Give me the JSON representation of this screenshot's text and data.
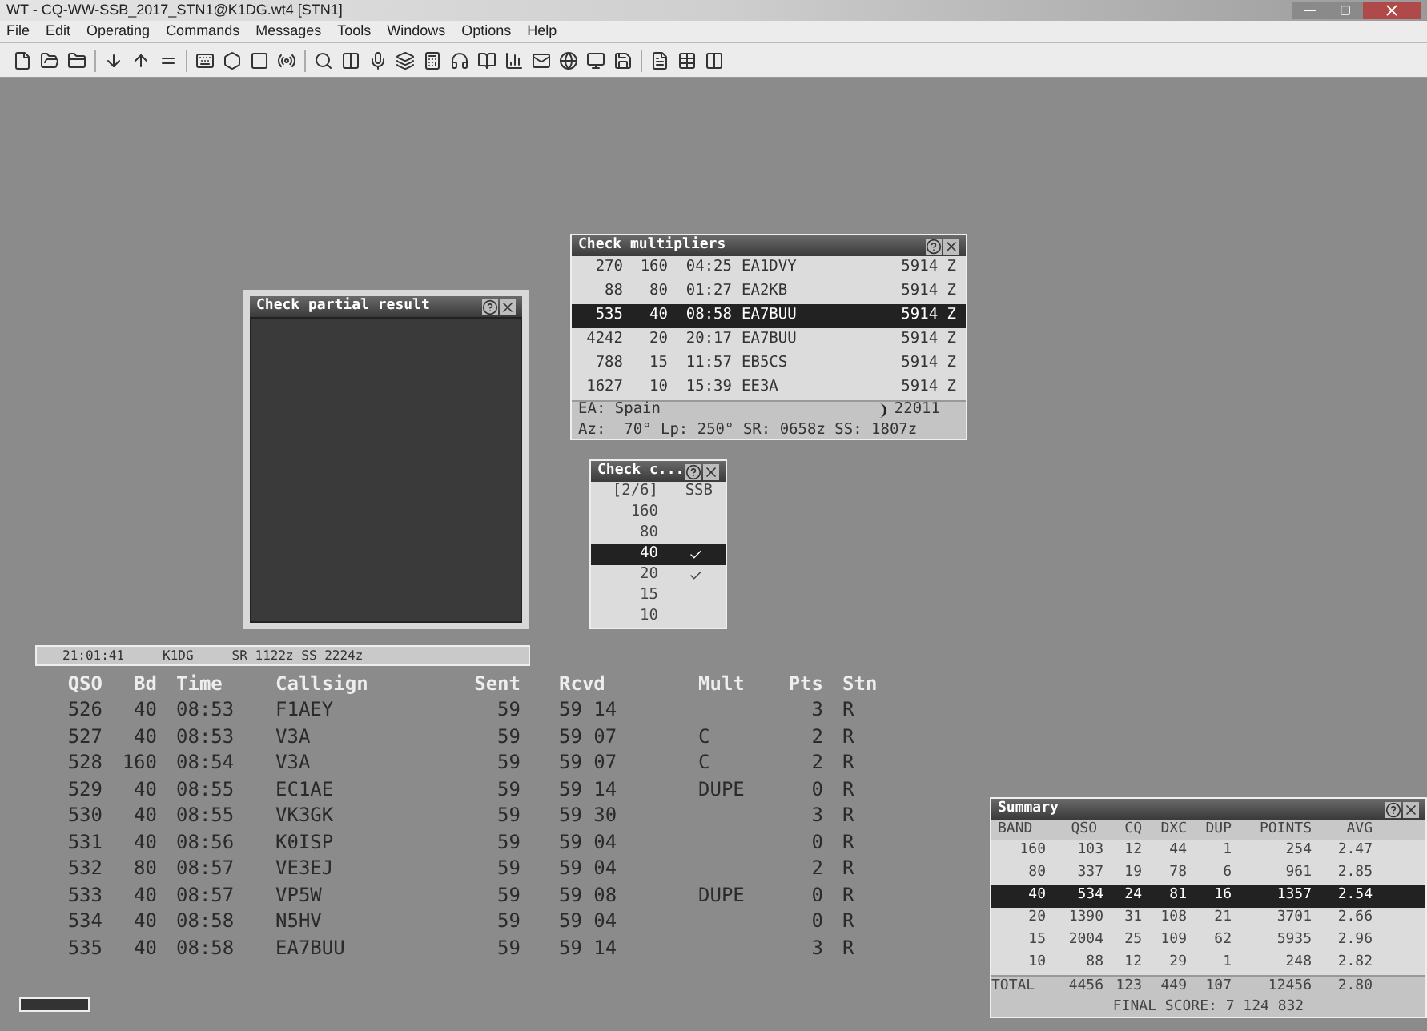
{
  "window": {
    "title": "WT - CQ-WW-SSB_2017_STN1@K1DG.wt4 [STN1]"
  },
  "menu": [
    "File",
    "Edit",
    "Operating",
    "Commands",
    "Messages",
    "Tools",
    "Windows",
    "Options",
    "Help"
  ],
  "check_multipliers": {
    "title": "Check multipliers",
    "rows": [
      {
        "qso": "270",
        "band": "160",
        "time": "04:25",
        "callsign": "EA1DVY",
        "col_5": "5914 Z",
        "selected": false
      },
      {
        "qso": "88",
        "band": "80",
        "time": "01:27",
        "callsign": "EA2KB",
        "col_5": "5914 Z",
        "selected": false
      },
      {
        "qso": "535",
        "band": "40",
        "time": "08:58",
        "callsign": "EA7BUU",
        "col_5": "5914 Z",
        "selected": true
      },
      {
        "qso": "4242",
        "band": "20",
        "time": "20:17",
        "callsign": "EA7BUU",
        "col_5": "5914 Z",
        "selected": false
      },
      {
        "qso": "788",
        "band": "15",
        "time": "11:57",
        "callsign": "EB5CS",
        "col_5": "5914 Z",
        "selected": false
      },
      {
        "qso": "1627",
        "band": "10",
        "time": "15:39",
        "callsign": "EE3A",
        "col_5": "5914 Z",
        "selected": false
      }
    ],
    "country": "EA: Spain",
    "zone": "22011",
    "bearing": "Az:  70° Lp: 250° SR: 0658z SS: 1807z"
  },
  "check_partial": {
    "title": "Check partial result"
  },
  "check_bands": {
    "title": "Check c...",
    "header": [
      "[2/6]",
      "SSB"
    ],
    "rows": [
      {
        "band": "160",
        "checked": false,
        "selected": false
      },
      {
        "band": "80",
        "checked": false,
        "selected": false
      },
      {
        "band": "40",
        "checked": true,
        "selected": true
      },
      {
        "band": "20",
        "checked": true,
        "selected": false
      },
      {
        "band": "15",
        "checked": false,
        "selected": false
      },
      {
        "band": "10",
        "checked": false,
        "selected": false
      }
    ]
  },
  "status_strip": [
    "21:01:41",
    "K1DG",
    "SR 1122z SS 2224z"
  ],
  "log": {
    "columns": [
      "QSO",
      "Bd",
      "Time",
      "Callsign",
      "Sent",
      "Rcvd",
      "Mult",
      "Pts",
      "Stn"
    ],
    "rows": [
      [
        "526",
        "40",
        "08:53",
        "F1AEY",
        "59",
        "59 14",
        "",
        "3",
        "R"
      ],
      [
        "527",
        "40",
        "08:53",
        "V3A",
        "59",
        "59 07",
        "C",
        "2",
        "R"
      ],
      [
        "528",
        "160",
        "08:54",
        "V3A",
        "59",
        "59 07",
        "C",
        "2",
        "R"
      ],
      [
        "529",
        "40",
        "08:55",
        "EC1AE",
        "59",
        "59 14",
        "DUPE",
        "0",
        "R"
      ],
      [
        "530",
        "40",
        "08:55",
        "VK3GK",
        "59",
        "59 30",
        "",
        "3",
        "R"
      ],
      [
        "531",
        "40",
        "08:56",
        "K0ISP",
        "59",
        "59 04",
        "",
        "0",
        "R"
      ],
      [
        "532",
        "80",
        "08:57",
        "VE3EJ",
        "59",
        "59 04",
        "",
        "2",
        "R"
      ],
      [
        "533",
        "40",
        "08:57",
        "VP5W",
        "59",
        "59 08",
        "DUPE",
        "0",
        "R"
      ],
      [
        "534",
        "40",
        "08:58",
        "N5HV",
        "59",
        "59 04",
        "",
        "0",
        "R"
      ],
      [
        "535",
        "40",
        "08:58",
        "EA7BUU",
        "59",
        "59 14",
        "",
        "3",
        "R"
      ]
    ]
  },
  "summary": {
    "title": "Summary",
    "columns": [
      "BAND",
      "QSO",
      "CQ",
      "DXC",
      "DUP",
      "POINTS",
      "AVG"
    ],
    "rows": [
      {
        "cells": [
          "160",
          "103",
          "12",
          "44",
          "1",
          "254",
          "2.47"
        ],
        "selected": false
      },
      {
        "cells": [
          "80",
          "337",
          "19",
          "78",
          "6",
          "961",
          "2.85"
        ],
        "selected": false
      },
      {
        "cells": [
          "40",
          "534",
          "24",
          "81",
          "16",
          "1357",
          "2.54"
        ],
        "selected": true
      },
      {
        "cells": [
          "20",
          "1390",
          "31",
          "108",
          "21",
          "3701",
          "2.66"
        ],
        "selected": false
      },
      {
        "cells": [
          "15",
          "2004",
          "25",
          "109",
          "62",
          "5935",
          "2.96"
        ],
        "selected": false
      },
      {
        "cells": [
          "10",
          "88",
          "12",
          "29",
          "1",
          "248",
          "2.82"
        ],
        "selected": false
      }
    ],
    "total": [
      "TOTAL",
      "4456",
      "123",
      "449",
      "107",
      "12456",
      "2.80"
    ],
    "final_score": "FINAL SCORE: 7 124 832"
  }
}
